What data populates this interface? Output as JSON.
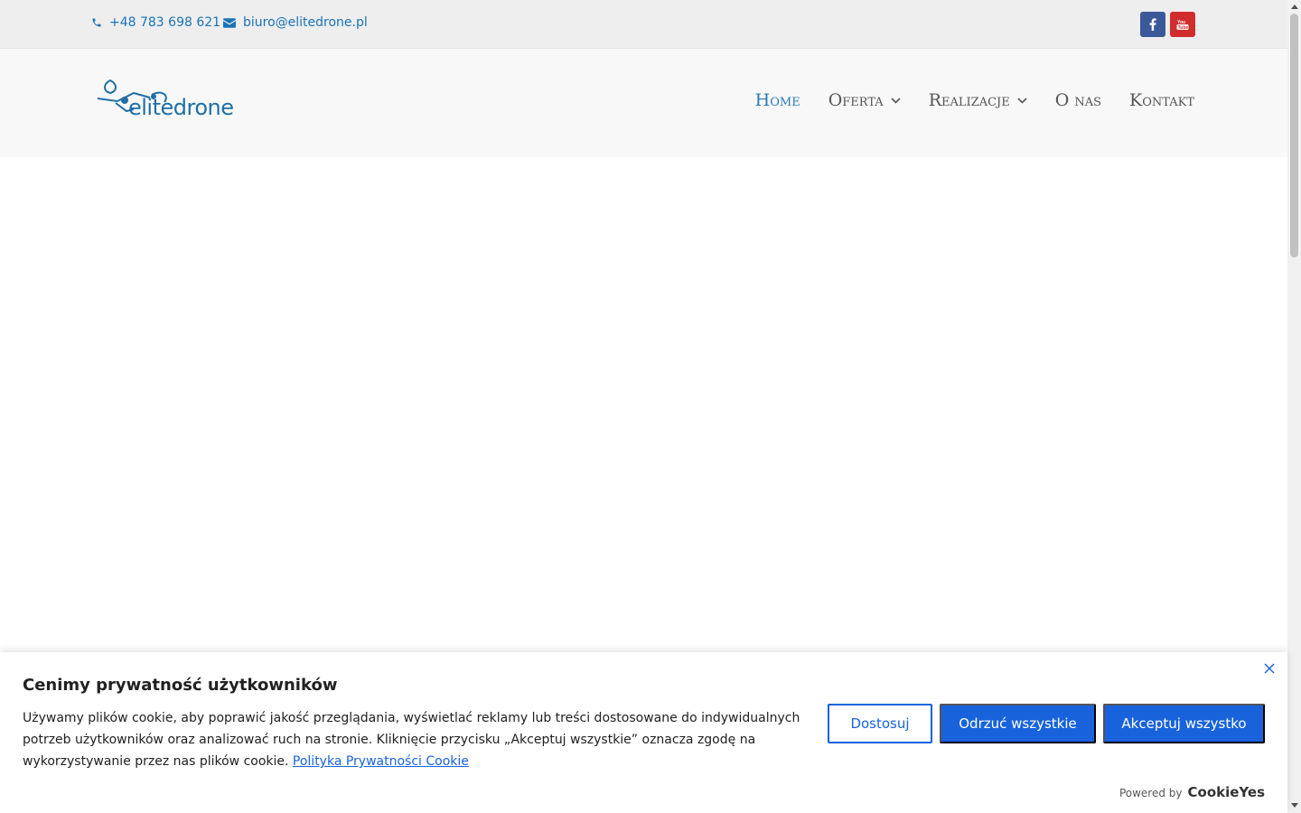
{
  "topbar": {
    "phone": "+48 783 698 621",
    "email": "biuro@elitedrone.pl",
    "icons": [
      "phone-icon",
      "envelope-icon",
      "facebook-icon",
      "youtube-icon"
    ],
    "colors": {
      "facebook": "#3b5998",
      "youtube": "#d12d2d",
      "link": "#1a73b8"
    }
  },
  "header": {
    "logo_text": "elitedrone",
    "nav": [
      {
        "label": "Home",
        "active": true
      },
      {
        "label": "Oferta",
        "dropdown": true
      },
      {
        "label": "Realizacje",
        "dropdown": true
      },
      {
        "label": "O nas"
      },
      {
        "label": "Kontakt"
      }
    ]
  },
  "cookie": {
    "title": "Cenimy prywatność użytkowników",
    "text": "Używamy plików cookie, aby poprawić jakość przeglądania, wyświetlać reklamy lub treści dostosowane do indywidualnych potrzeb użytkowników oraz analizować ruch na stronie. Kliknięcie przycisku „Akceptuj wszystkie” oznacza zgodę na wykorzystywanie przez nas plików cookie.",
    "link_text": "Polityka Prywatności Cookie",
    "buttons": {
      "customize": "Dostosuj",
      "reject": "Odrzuć wszystkie",
      "accept": "Akceptuj wszystko"
    },
    "powered_by": "Powered by",
    "brand": "CookieYes",
    "accent_color": "#1863dc"
  }
}
